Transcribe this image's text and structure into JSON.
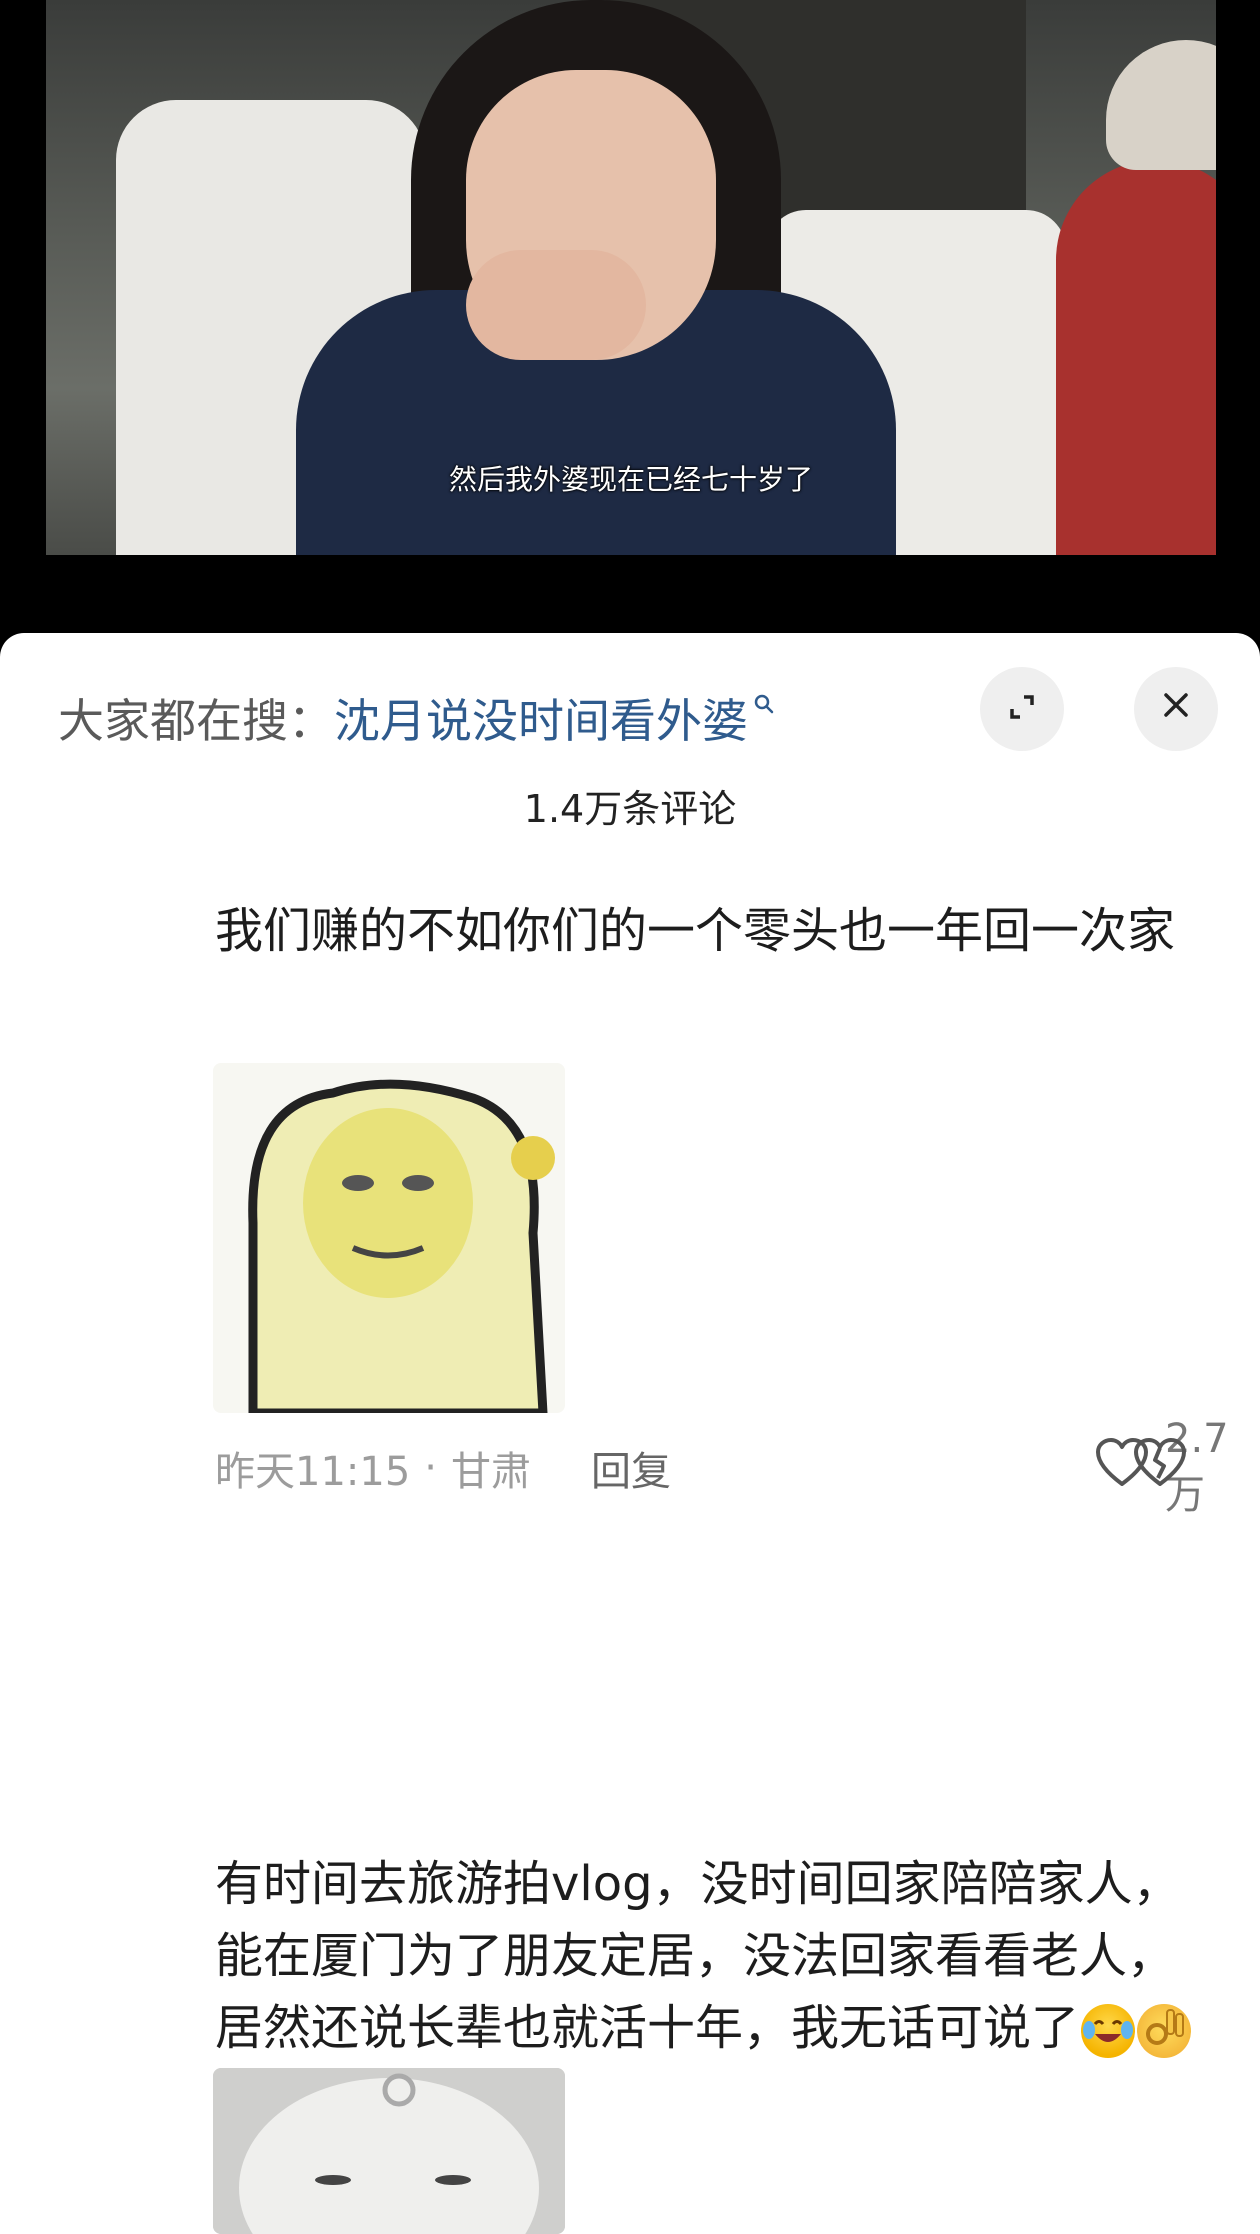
{
  "video": {
    "subtitle": "然后我外婆现在已经七十岁了"
  },
  "comments_sheet": {
    "search_prefix": "大家都在搜：",
    "search_term": "沈月说没时间看外婆",
    "comment_count": "1.4万条评论",
    "icons": {
      "search": "search-icon",
      "expand": "expand-icon",
      "close": "close-icon",
      "like": "heart-outline-icon",
      "dislike": "broken-heart-icon"
    },
    "comments": [
      {
        "text": "我们赚的不如你们的一个零头也一年回一次家",
        "sticker": "meme-sticker",
        "time": "昨天11:15",
        "separator": "·",
        "location": "甘肃",
        "reply_label": "回复",
        "likes": "2.7万"
      },
      {
        "text": "有时间去旅游拍vlog，没时间回家陪陪家人，能在厦门为了朋友定居，没法回家看看老人，居然还说长辈也就活十年，我无话可说了",
        "emojis": [
          "laughing-crying-emoji",
          "ok-hand-emoji"
        ],
        "sticker": "meme-sticker"
      }
    ]
  },
  "colors": {
    "search_term": "#2f5b8d",
    "meta_text": "#9c9c9c",
    "sheet_bg": "#ffffff",
    "page_bg": "#000000"
  }
}
